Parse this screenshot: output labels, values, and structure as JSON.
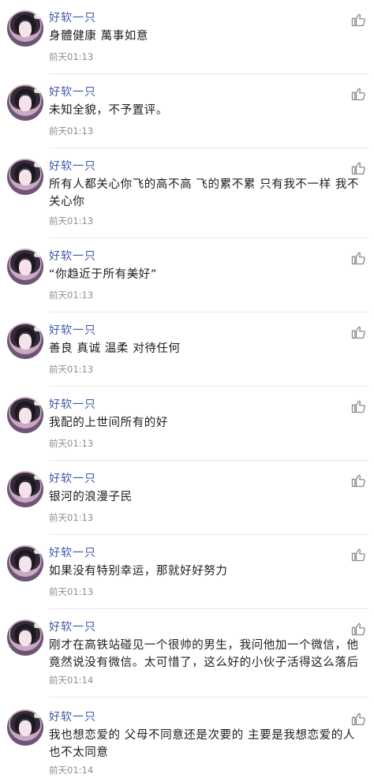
{
  "comments": [
    {
      "user": "好软一只",
      "text": [
        "身體健康 萬事如意"
      ],
      "time": "前天01:13"
    },
    {
      "user": "好软一只",
      "text": [
        "未知全貌，不予置评。"
      ],
      "time": "前天01:13"
    },
    {
      "user": "好软一只",
      "text": [
        "所有人都关心你飞的高不高 飞的累不累 只有我不一样 我不",
        "关心你"
      ],
      "time": "前天01:13"
    },
    {
      "user": "好软一只",
      "text": [
        "“你趋近于所有美好”"
      ],
      "time": "前天01:13"
    },
    {
      "user": "好软一只",
      "text": [
        "善良 真诚 温柔 对待任何"
      ],
      "time": "前天01:13"
    },
    {
      "user": "好软一只",
      "text": [
        "我配的上世间所有的好"
      ],
      "time": "前天01:13"
    },
    {
      "user": "好软一只",
      "text": [
        "银河的浪漫子民"
      ],
      "time": "前天01:13"
    },
    {
      "user": "好软一只",
      "text": [
        "如果没有特别幸运，那就好好努力"
      ],
      "time": "前天01:13"
    },
    {
      "user": "好软一只",
      "text": [
        "刚才在高铁站碰见一个很帅的男生，我问他加一个微信，他",
        "竟然说没有微信。太可惜了，这么好的小伙子活得这么落后"
      ],
      "time": "前天01:14"
    },
    {
      "user": "好软一只",
      "text": [
        "我也想恋爱的 父母不同意还是次要的 主要是我想恋爱的人",
        "也不太同意"
      ],
      "time": "前天01:14"
    }
  ],
  "icons": {
    "like": "thumbs-up-icon",
    "avatar": "user-avatar"
  }
}
